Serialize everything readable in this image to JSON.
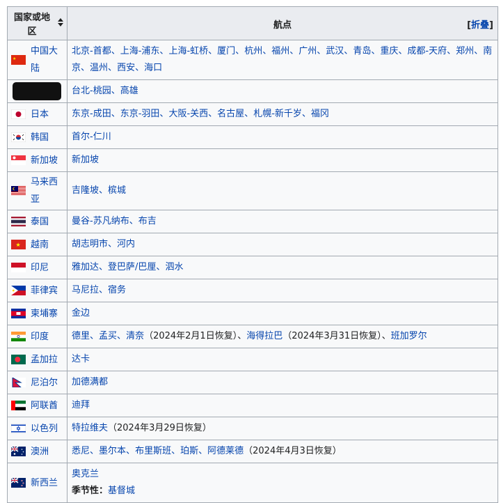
{
  "table": {
    "header": {
      "country_col": "国家或地区",
      "routes_col": "航点",
      "collapse_open": "[",
      "collapse_label": "折叠",
      "collapse_close": "]"
    },
    "rows": [
      {
        "country": "中国大陆",
        "flag": "china-flag-icon",
        "routes": [
          {
            "t": "北京-首都"
          },
          {
            "t": "上海-浦东"
          },
          {
            "t": "上海-虹桥"
          },
          {
            "t": "厦门"
          },
          {
            "t": "杭州"
          },
          {
            "t": "福州"
          },
          {
            "t": "广州"
          },
          {
            "t": "武汉"
          },
          {
            "t": "青岛"
          },
          {
            "t": "重庆"
          },
          {
            "t": "成都-天府"
          },
          {
            "t": "郑州"
          },
          {
            "t": "南京"
          },
          {
            "t": "温州"
          },
          {
            "t": "西安"
          },
          {
            "t": "海口"
          }
        ]
      },
      {
        "country": "",
        "flag": "redacted",
        "routes": [
          {
            "t": "台北-桃园"
          },
          {
            "t": "高雄"
          }
        ]
      },
      {
        "country": "日本",
        "flag": "japan-flag-icon",
        "routes": [
          {
            "t": "东京-成田"
          },
          {
            "t": "东京-羽田"
          },
          {
            "t": "大阪-关西"
          },
          {
            "t": "名古屋"
          },
          {
            "t": "札幌-新千岁"
          },
          {
            "t": "福冈"
          }
        ]
      },
      {
        "country": "韩国",
        "flag": "korea-flag-icon",
        "routes": [
          {
            "t": "首尔-仁川"
          }
        ]
      },
      {
        "country": "新加坡",
        "flag": "singapore-flag-icon",
        "routes": [
          {
            "t": "新加坡"
          }
        ]
      },
      {
        "country": "马来西亚",
        "flag": "malaysia-flag-icon",
        "routes": [
          {
            "t": "吉隆坡"
          },
          {
            "t": "槟城"
          }
        ]
      },
      {
        "country": "泰国",
        "flag": "thailand-flag-icon",
        "routes": [
          {
            "t": "曼谷-苏凡纳布"
          },
          {
            "t": "布吉"
          }
        ]
      },
      {
        "country": "越南",
        "flag": "vietnam-flag-icon",
        "routes": [
          {
            "t": "胡志明市"
          },
          {
            "t": "河内"
          }
        ]
      },
      {
        "country": "印尼",
        "flag": "indonesia-flag-icon",
        "routes": [
          {
            "t": "雅加达"
          },
          {
            "t": "登巴萨/巴厘",
            "sep": "、"
          },
          {
            "t": "泗水"
          }
        ]
      },
      {
        "country": "菲律宾",
        "flag": "philippines-flag-icon",
        "routes": [
          {
            "t": "马尼拉"
          },
          {
            "t": "宿务"
          }
        ]
      },
      {
        "country": "柬埔寨",
        "flag": "cambodia-flag-icon",
        "routes": [
          {
            "t": "金边"
          }
        ]
      },
      {
        "country": "印度",
        "flag": "india-flag-icon",
        "routes": [
          {
            "t": "德里"
          },
          {
            "t": "孟买"
          },
          {
            "t": "清奈",
            "note": "（2024年2月1日恢复）"
          },
          {
            "t": "海得拉巴",
            "note": "（2024年3月31日恢复）"
          },
          {
            "t": "班加罗尔"
          }
        ]
      },
      {
        "country": "孟加拉",
        "flag": "bangladesh-flag-icon",
        "routes": [
          {
            "t": "达卡"
          }
        ]
      },
      {
        "country": "尼泊尔",
        "flag": "nepal-flag-icon",
        "routes": [
          {
            "t": "加德满都"
          }
        ]
      },
      {
        "country": "阿联酋",
        "flag": "uae-flag-icon",
        "routes": [
          {
            "t": "迪拜"
          }
        ]
      },
      {
        "country": "以色列",
        "flag": "israel-flag-icon",
        "routes": [
          {
            "t": "特拉维夫",
            "note": "（2024年3月29日恢复）"
          }
        ]
      },
      {
        "country": "澳洲",
        "flag": "australia-flag-icon",
        "routes": [
          {
            "t": "悉尼"
          },
          {
            "t": "墨尔本"
          },
          {
            "t": "布里斯班"
          },
          {
            "t": "珀斯"
          },
          {
            "t": "阿德莱德",
            "note": "（2024年4月3日恢复）"
          }
        ]
      },
      {
        "country": "新西兰",
        "flag": "newzealand-flag-icon",
        "routes": [
          {
            "t": "奥克兰"
          }
        ],
        "seasonal_label": "季节性：",
        "seasonal": [
          {
            "t": "基督城"
          }
        ]
      }
    ]
  },
  "separator": "、",
  "colors": {
    "link": "#0645ad",
    "border": "#a2a9b1",
    "header_bg": "#eaecf0",
    "cell_bg": "#f8f9fa"
  }
}
